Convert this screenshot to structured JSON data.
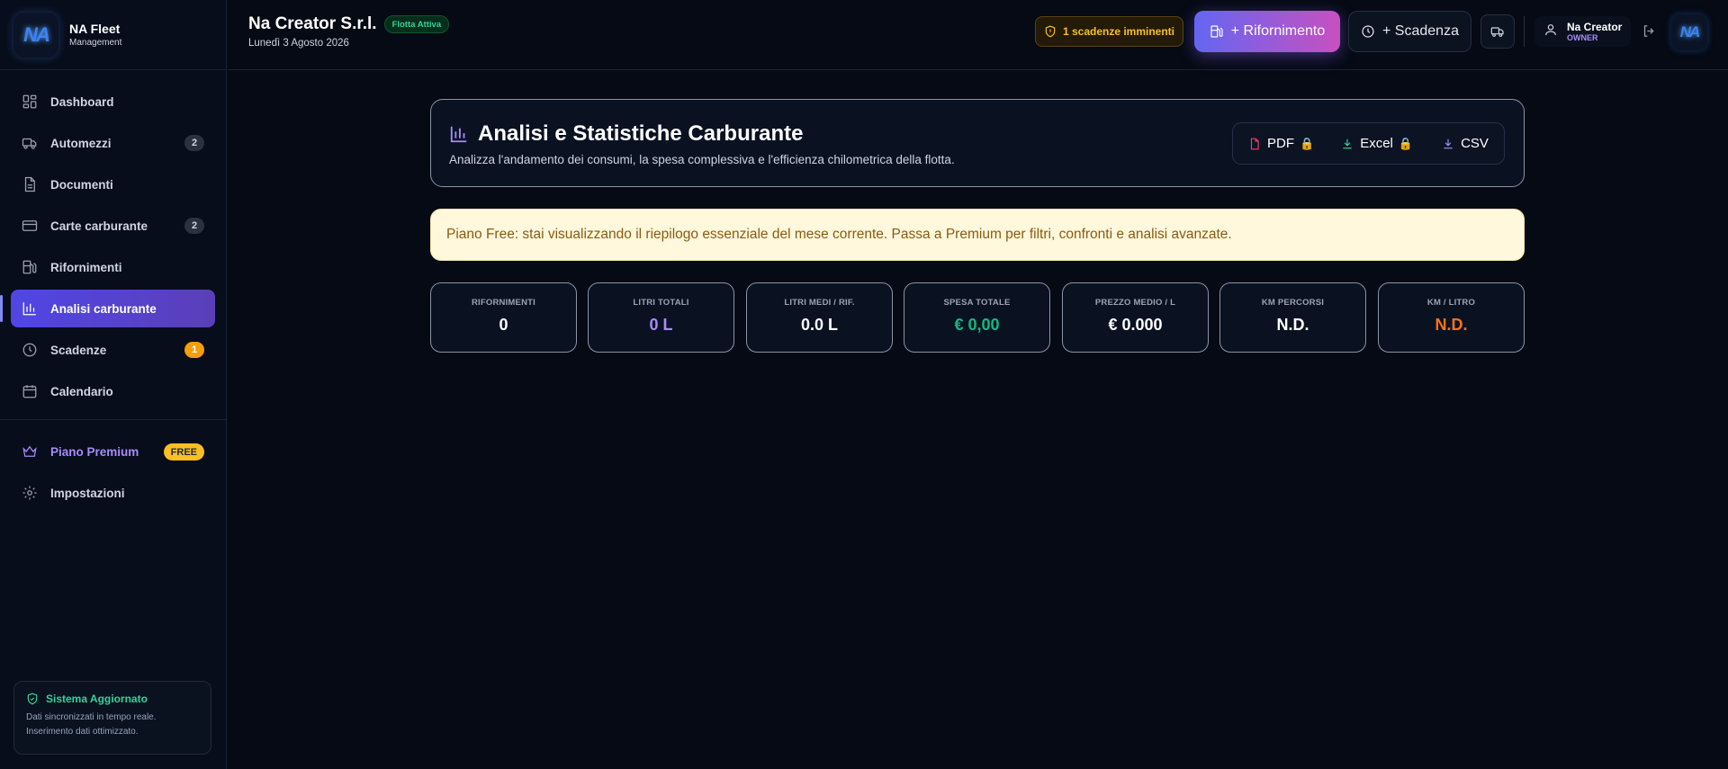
{
  "brand": {
    "logo_text": "NA",
    "name": "NA Fleet",
    "subtitle": "Management"
  },
  "nav": {
    "items": [
      {
        "label": "Dashboard"
      },
      {
        "label": "Automezzi",
        "badge": "2"
      },
      {
        "label": "Documenti"
      },
      {
        "label": "Carte carburante",
        "badge": "2"
      },
      {
        "label": "Rifornimenti"
      },
      {
        "label": "Analisi carburante",
        "active": true
      },
      {
        "label": "Scadenze",
        "badge": "1"
      },
      {
        "label": "Calendario"
      }
    ],
    "premium": {
      "label": "Piano Premium",
      "badge": "FREE"
    },
    "settings": {
      "label": "Impostazioni"
    }
  },
  "system": {
    "title": "Sistema Aggiornato",
    "line1": "Dati sincronizzati in tempo reale.",
    "line2": "Inserimento dati ottimizzato."
  },
  "header": {
    "company": "Na Creator S.r.l.",
    "fleet_status": "Flotta Attiva",
    "date": "Lunedì 3 Agosto 2026",
    "alert": "1 scadenze imminenti",
    "add_refuel": "+ Rifornimento",
    "add_deadline": "+ Scadenza",
    "user_name": "Na Creator",
    "user_role": "OWNER",
    "avatar_text": "NA"
  },
  "page": {
    "title": "Analisi e Statistiche Carburante",
    "subtitle": "Analizza l'andamento dei consumi, la spesa complessiva e l'efficienza chilometrica della flotta.",
    "export": {
      "pdf": "PDF",
      "excel": "Excel",
      "csv": "CSV",
      "lock": "🔒"
    },
    "banner": "Piano Free: stai visualizzando il riepilogo essenziale del mese corrente. Passa a Premium per filtri, confronti e analisi avanzate."
  },
  "stats": [
    {
      "label": "RIFORNIMENTI",
      "value": "0",
      "color": "#ffffff"
    },
    {
      "label": "LITRI TOTALI",
      "value": "0 L",
      "color": "#a78bfa"
    },
    {
      "label": "LITRI MEDI / RIF.",
      "value": "0.0 L",
      "color": "#ffffff"
    },
    {
      "label": "SPESA TOTALE",
      "value": "€ 0,00",
      "color": "#10b981"
    },
    {
      "label": "PREZZO MEDIO / L",
      "value": "€ 0.000",
      "color": "#ffffff"
    },
    {
      "label": "KM PERCORSI",
      "value": "N.D.",
      "color": "#ffffff"
    },
    {
      "label": "KM / LITRO",
      "value": "N.D.",
      "color": "#f97316"
    }
  ]
}
